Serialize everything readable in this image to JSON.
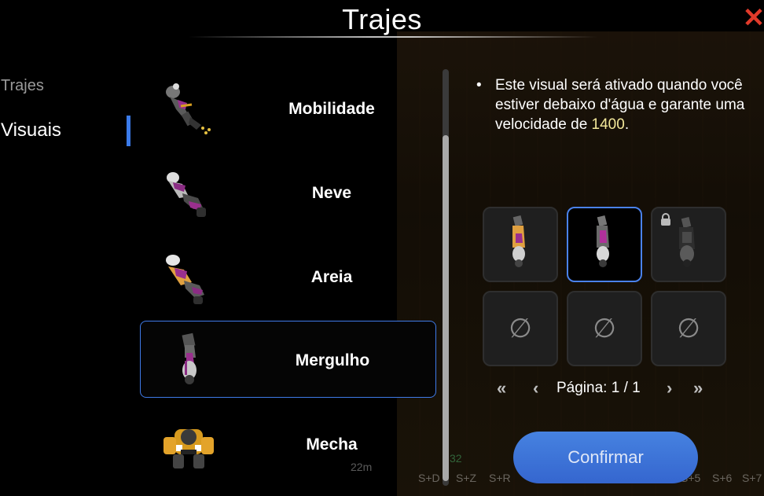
{
  "window": {
    "title": "Trajes"
  },
  "sidebar": {
    "categories": [
      {
        "label": "Trajes",
        "active": false
      },
      {
        "label": "Visuais",
        "active": true
      }
    ]
  },
  "outfits": [
    {
      "label": "Mobilidade",
      "icon": "mobility-suit-icon",
      "selected": false
    },
    {
      "label": "Neve",
      "icon": "snow-suit-icon",
      "selected": false
    },
    {
      "label": "Areia",
      "icon": "sand-suit-icon",
      "selected": false
    },
    {
      "label": "Mergulho",
      "icon": "diving-suit-icon",
      "selected": true
    },
    {
      "label": "Mecha",
      "icon": "mecha-suit-icon",
      "selected": false
    }
  ],
  "detail": {
    "description_before": "Este visual será ativado quando você estiver debaixo d'água e garante uma velocidade de ",
    "speed": "1400",
    "description_after": "."
  },
  "visuals": {
    "slots": [
      {
        "state": "available",
        "icon": "diving-skin-orange-icon"
      },
      {
        "state": "selected",
        "icon": "diving-skin-pink-icon"
      },
      {
        "state": "locked",
        "icon": "diving-skin-dark-icon"
      },
      {
        "state": "empty",
        "symbol": "∅"
      },
      {
        "state": "empty",
        "symbol": "∅"
      },
      {
        "state": "empty",
        "symbol": "∅"
      }
    ],
    "pagination": {
      "text": "Página: 1 / 1",
      "first": "«",
      "prev": "‹",
      "next": "›",
      "last": "»"
    }
  },
  "actions": {
    "confirm_label": "Confirmar"
  },
  "hud_background": {
    "level_text": "22m",
    "hotkeys": [
      "S+D",
      "S+Z",
      "S+R",
      "S+5",
      "S+6",
      "S+7"
    ],
    "count": "32"
  },
  "colors": {
    "accent": "#3b7bea",
    "close": "#e03a2a",
    "highlight_number": "#f3e79a",
    "button": "#3a6fd8"
  }
}
